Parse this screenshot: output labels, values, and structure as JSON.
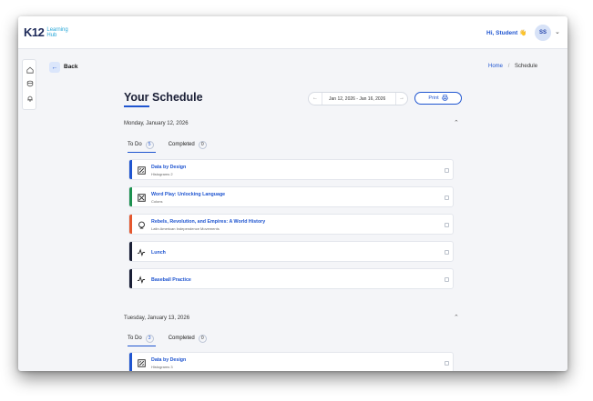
{
  "header": {
    "logo_main": "K12",
    "logo_line1": "Learning",
    "logo_line2": "Hub",
    "greeting": "Hi, Student",
    "greeting_emoji": "👋",
    "avatar_initials": "SS"
  },
  "sidenav": {
    "items": [
      {
        "icon": "home-icon",
        "glyph": "⌂"
      },
      {
        "icon": "cube-icon",
        "glyph": "⬡"
      },
      {
        "icon": "bell-icon",
        "glyph": "🔔"
      }
    ]
  },
  "nav": {
    "back_label": "Back",
    "breadcrumb_home": "Home",
    "breadcrumb_sep": "/",
    "breadcrumb_current": "Schedule"
  },
  "page": {
    "title": "Your Schedule",
    "date_range": "Jan 12, 2026 - Jan 16, 2026",
    "print_label": "Print"
  },
  "days": [
    {
      "date": "Monday, January 12, 2026",
      "todo_label": "To Do",
      "todo_count": "5",
      "completed_label": "Completed",
      "completed_count": "0",
      "items": [
        {
          "title": "Data by Design",
          "subtitle": "Histograms 2",
          "color": "#1f55d0",
          "icon": "chart-icon"
        },
        {
          "title": "Word Play: Unlocking Language",
          "subtitle": "Colons",
          "color": "#1d9150",
          "icon": "puzzle-icon"
        },
        {
          "title": "Rebels, Revolution, and Empires: A World History",
          "subtitle": "Latin American Independence Movements",
          "color": "#e4572e",
          "icon": "globe-icon"
        },
        {
          "title": "Lunch",
          "subtitle": "",
          "color": "#1a1f36",
          "icon": "activity-icon"
        },
        {
          "title": "Baseball Practice",
          "subtitle": "",
          "color": "#1a1f36",
          "icon": "activity-icon"
        }
      ]
    },
    {
      "date": "Tuesday, January 13, 2026",
      "todo_label": "To Do",
      "todo_count": "3",
      "completed_label": "Completed",
      "completed_count": "0",
      "items": [
        {
          "title": "Data by Design",
          "subtitle": "Histograms 3",
          "color": "#1f55d0",
          "icon": "chart-icon"
        }
      ]
    }
  ]
}
